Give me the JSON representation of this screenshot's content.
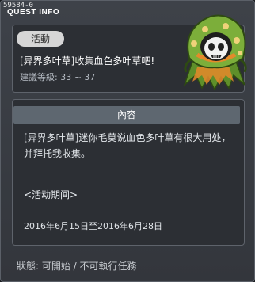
{
  "window": {
    "quest_id": "59584-0",
    "title": "QUEST INFO"
  },
  "quest": {
    "category_badge": "活動",
    "title": "[异界多叶草]收集血色多叶草吧!",
    "level": "建議等級: 33 ~ 37"
  },
  "content": {
    "header": "內容",
    "description": "[异界多叶草]迷你毛莫说血色多叶草有很大用处，并拜托我收集。",
    "period_label": "<活动期间>",
    "period_dates": "2016年6月15日至2016年6月28日"
  },
  "status": {
    "text": "狀態: 可開始 / 不可執行任務"
  },
  "npc": {
    "icon": "hooded-ghost-icon",
    "colors": {
      "hood": "#7cae3a",
      "trim": "#e58a2a",
      "face": "#f2f2f2"
    }
  }
}
